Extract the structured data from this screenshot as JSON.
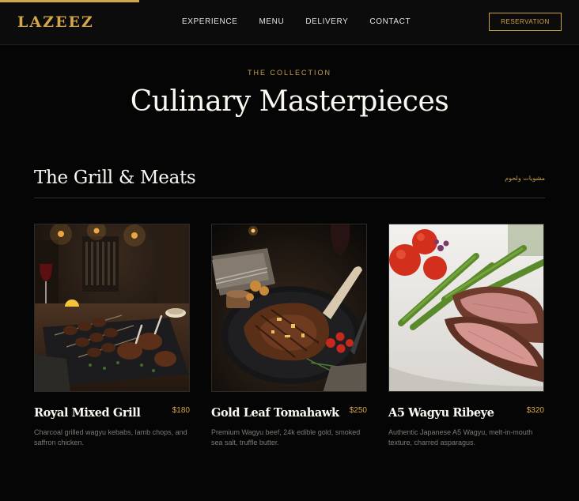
{
  "header": {
    "logo": "LAZEEZ",
    "progress": 0.24,
    "nav": [
      "EXPERIENCE",
      "MENU",
      "DELIVERY",
      "CONTACT"
    ],
    "reservation_label": "RESERVATION"
  },
  "hero": {
    "eyebrow": "THE COLLECTION",
    "title": "Culinary Masterpieces"
  },
  "section": {
    "title": "The Grill & Meats",
    "arabic": "مشويات ولحوم"
  },
  "dishes": [
    {
      "name": "Royal Mixed Grill",
      "price": "$180",
      "description": "Charcoal grilled wagyu kebabs, lamb chops, and saffron chicken."
    },
    {
      "name": "Gold Leaf Tomahawk",
      "price": "$250",
      "description": "Premium Wagyu beef, 24k edible gold, smoked sea salt, truffle butter."
    },
    {
      "name": "A5 Wagyu Ribeye",
      "price": "$320",
      "description": "Authentic Japanese A5 Wagyu, melt-in-mouth texture, charred asparagus."
    }
  ],
  "colors": {
    "accent": "#d4a64a",
    "background": "#050505",
    "text": "#fbf8f2",
    "muted": "#7d7a74"
  }
}
